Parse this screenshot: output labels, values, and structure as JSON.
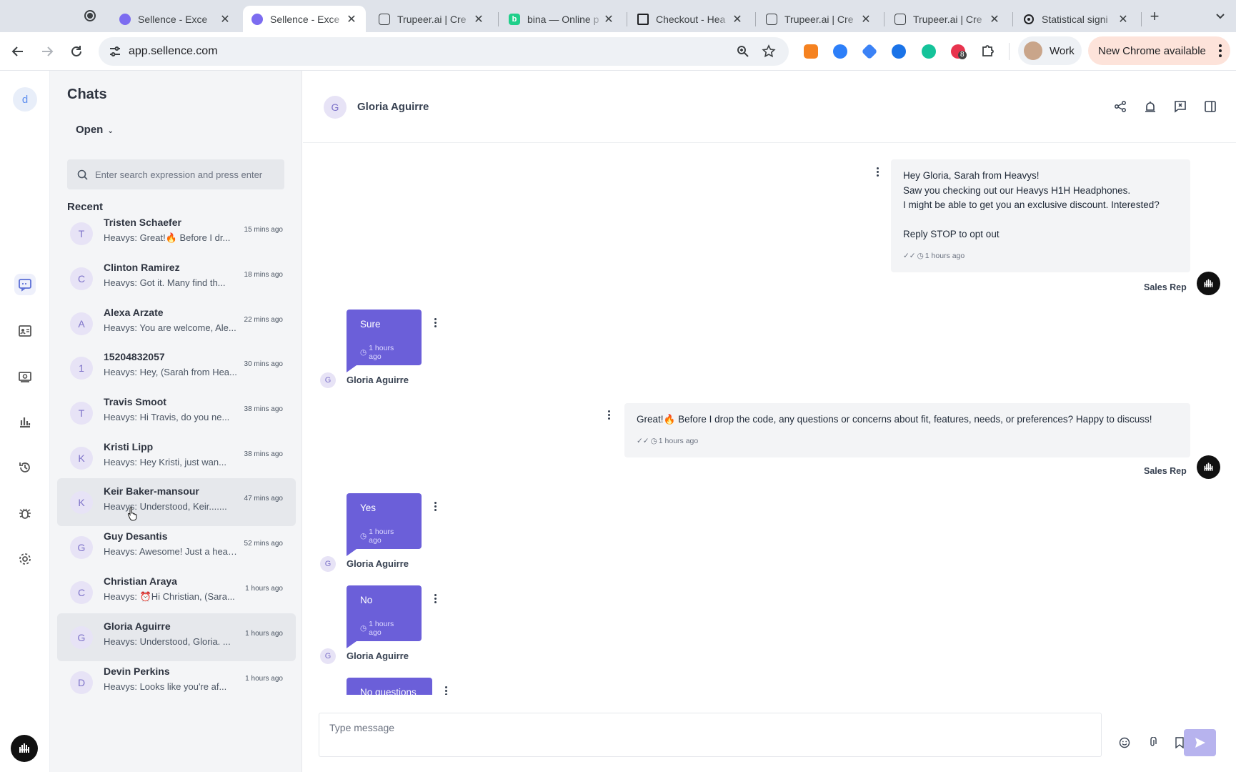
{
  "browser": {
    "tabs": [
      {
        "title": "Sellence - Exce",
        "favicon": "sellence-icon"
      },
      {
        "title": "Sellence - Exce",
        "favicon": "sellence-icon",
        "active": true
      },
      {
        "title": "Trupeer.ai | Cre",
        "favicon": "trupeer-icon"
      },
      {
        "title": "bina — Online p",
        "favicon": "bina-icon"
      },
      {
        "title": "Checkout - Hea",
        "favicon": "checkout-icon"
      },
      {
        "title": "Trupeer.ai | Cre",
        "favicon": "trupeer-icon"
      },
      {
        "title": "Trupeer.ai | Cre",
        "favicon": "trupeer-icon"
      },
      {
        "title": "Statistical signi",
        "favicon": "openai-icon"
      }
    ],
    "url": "app.sellence.com",
    "profile_label": "Work",
    "update_label": "New Chrome available",
    "extension_badge": "8"
  },
  "rail": {
    "workspace_initial": "d"
  },
  "chats": {
    "title": "Chats",
    "filter": "Open",
    "search_placeholder": "Enter search expression and press enter",
    "recent_label": "Recent",
    "items": [
      {
        "initial": "T",
        "name": "Tristen Schaefer",
        "preview": "Heavys: Great!🔥 Before I dr...",
        "time": "15 mins ago"
      },
      {
        "initial": "C",
        "name": "Clinton Ramirez",
        "preview": "Heavys: Got it. Many find th...",
        "time": "18 mins ago"
      },
      {
        "initial": "A",
        "name": "Alexa Arzate",
        "preview": "Heavys: You are welcome, Ale...",
        "time": "22 mins ago"
      },
      {
        "initial": "1",
        "name": "15204832057",
        "preview": "Heavys: Hey, (Sarah from Hea...",
        "time": "30 mins ago"
      },
      {
        "initial": "T",
        "name": "Travis Smoot",
        "preview": "Heavys: Hi Travis, do you ne...",
        "time": "38 mins ago"
      },
      {
        "initial": "K",
        "name": "Kristi Lipp",
        "preview": "Heavys: Hey Kristi, just wan...",
        "time": "38 mins ago"
      },
      {
        "initial": "K",
        "name": "Keir Baker-mansour",
        "preview": "Heavys: Understood, Keir.......",
        "time": "47 mins ago"
      },
      {
        "initial": "G",
        "name": "Guy Desantis",
        "preview": "Heavys: Awesome! Just a head...",
        "time": "52 mins ago"
      },
      {
        "initial": "C",
        "name": "Christian Araya",
        "preview": "Heavys: ⏰Hi Christian, (Sara...",
        "time": "1 hours ago"
      },
      {
        "initial": "G",
        "name": "Gloria Aguirre",
        "preview": "Heavys: Understood, Gloria. ...",
        "time": "1 hours ago"
      },
      {
        "initial": "D",
        "name": "Devin Perkins",
        "preview": "Heavys: Looks like you're af...",
        "time": "1 hours ago"
      }
    ]
  },
  "conversation": {
    "contact_initial": "G",
    "contact_name": "Gloria Aguirre",
    "messages": {
      "m1": {
        "lines": [
          "Hey Gloria, Sarah from Heavys!",
          "Saw you checking out our Heavys H1H Headphones.",
          "I might be able to get you an exclusive discount. Interested?",
          "Reply STOP to opt out"
        ],
        "time": "1 hours ago",
        "sender": "Sales Rep"
      },
      "m2": {
        "text": "Sure",
        "time": "1 hours ago",
        "sender": "Gloria Aguirre",
        "initial": "G"
      },
      "m3": {
        "text": "Great!🔥 Before I drop the code, any questions or concerns about fit, features, needs, or preferences? Happy to discuss!",
        "time": "1 hours ago",
        "sender": "Sales Rep"
      },
      "m4": {
        "text": "Yes",
        "time": "1 hours ago",
        "sender": "Gloria Aguirre",
        "initial": "G"
      },
      "m5": {
        "text": "No",
        "time": "1 hours ago",
        "sender": "Gloria Aguirre",
        "initial": "G"
      },
      "m6": {
        "text": "No questions"
      }
    },
    "composer_placeholder": "Type message"
  }
}
